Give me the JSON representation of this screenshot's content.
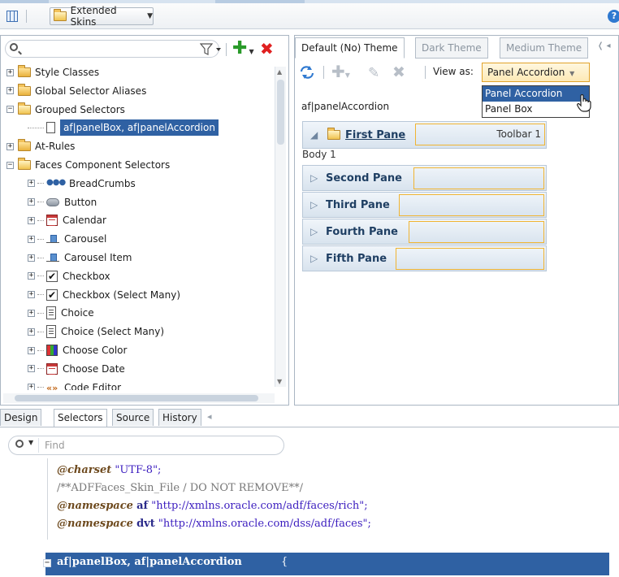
{
  "toolbar": {
    "skins_label": "Extended Skins",
    "help_label": "?"
  },
  "left_panel": {
    "search_placeholder": "",
    "tree": [
      {
        "label": "Style Classes",
        "icon": "folder-icon",
        "expander": "+",
        "indent": 0
      },
      {
        "label": "Global Selector Aliases",
        "icon": "folder-icon",
        "expander": "+",
        "indent": 0
      },
      {
        "label": "Grouped Selectors",
        "icon": "folder-open-icon",
        "expander": "-",
        "indent": 0
      },
      {
        "label": "af|panelBox, af|panelAccordion",
        "icon": "page-icon",
        "expander": "",
        "indent": 1,
        "selected": true
      },
      {
        "label": "At-Rules",
        "icon": "folder-icon",
        "expander": "+",
        "indent": 0
      },
      {
        "label": "Faces Component Selectors",
        "icon": "folder-open-icon",
        "expander": "-",
        "indent": 0
      },
      {
        "label": "BreadCrumbs",
        "icon": "breadcrumbs-icon",
        "expander": "+",
        "indent": 1
      },
      {
        "label": "Button",
        "icon": "button-icon",
        "expander": "+",
        "indent": 1
      },
      {
        "label": "Calendar",
        "icon": "calendar-icon",
        "expander": "+",
        "indent": 1
      },
      {
        "label": "Carousel",
        "icon": "carousel-icon",
        "expander": "+",
        "indent": 1
      },
      {
        "label": "Carousel Item",
        "icon": "carousel-item-icon",
        "expander": "+",
        "indent": 1
      },
      {
        "label": "Checkbox",
        "icon": "checkbox-icon",
        "expander": "+",
        "indent": 1
      },
      {
        "label": "Checkbox (Select Many)",
        "icon": "checkbox-icon",
        "expander": "+",
        "indent": 1
      },
      {
        "label": "Choice",
        "icon": "choice-icon",
        "expander": "+",
        "indent": 1
      },
      {
        "label": "Choice (Select Many)",
        "icon": "choice-icon",
        "expander": "+",
        "indent": 1
      },
      {
        "label": "Choose Color",
        "icon": "color-icon",
        "expander": "+",
        "indent": 1
      },
      {
        "label": "Choose Date",
        "icon": "calendar-icon",
        "expander": "+",
        "indent": 1
      },
      {
        "label": "Code Editor",
        "icon": "code-icon",
        "expander": "+",
        "indent": 1
      }
    ]
  },
  "bottom_tabs": [
    "Design",
    "Selectors",
    "Source",
    "History"
  ],
  "right_panel": {
    "theme_tabs": [
      "Default (No) Theme",
      "Dark Theme",
      "Medium Theme"
    ],
    "view_as_label": "View as:",
    "view_as_value": "Panel Accordion",
    "view_as_options": [
      "Panel Accordion",
      "Panel Box"
    ],
    "selector_label": "af|panelAccordion",
    "first_pane": "First Pane",
    "toolbar_label": "Toolbar 1",
    "body_label": "Body 1",
    "panes": [
      "Second Pane",
      "Third Pane",
      "Fourth Pane",
      "Fifth Pane"
    ]
  },
  "source": {
    "find_placeholder": "Find",
    "charset_kw": "@charset",
    "charset_val": "\"UTF-8\";",
    "comment": "/**ADFFaces_Skin_File / DO NOT REMOVE**/",
    "ns1_kw": "@namespace",
    "ns1_prefix": "af",
    "ns1_url": "\"http://xmlns.oracle.com/adf/faces/rich\";",
    "ns2_kw": "@namespace",
    "ns2_prefix": "dvt",
    "ns2_url": "\"http://xmlns.oracle.com/dss/adf/faces\";",
    "selector_line": "af|panelBox, af|panelAccordion",
    "open_brace": "{"
  },
  "colors": {
    "selection": "#2f61a3",
    "accent_orange": "#f0b432",
    "keyword": "#6e4a1e",
    "string": "#3b1dbf"
  }
}
